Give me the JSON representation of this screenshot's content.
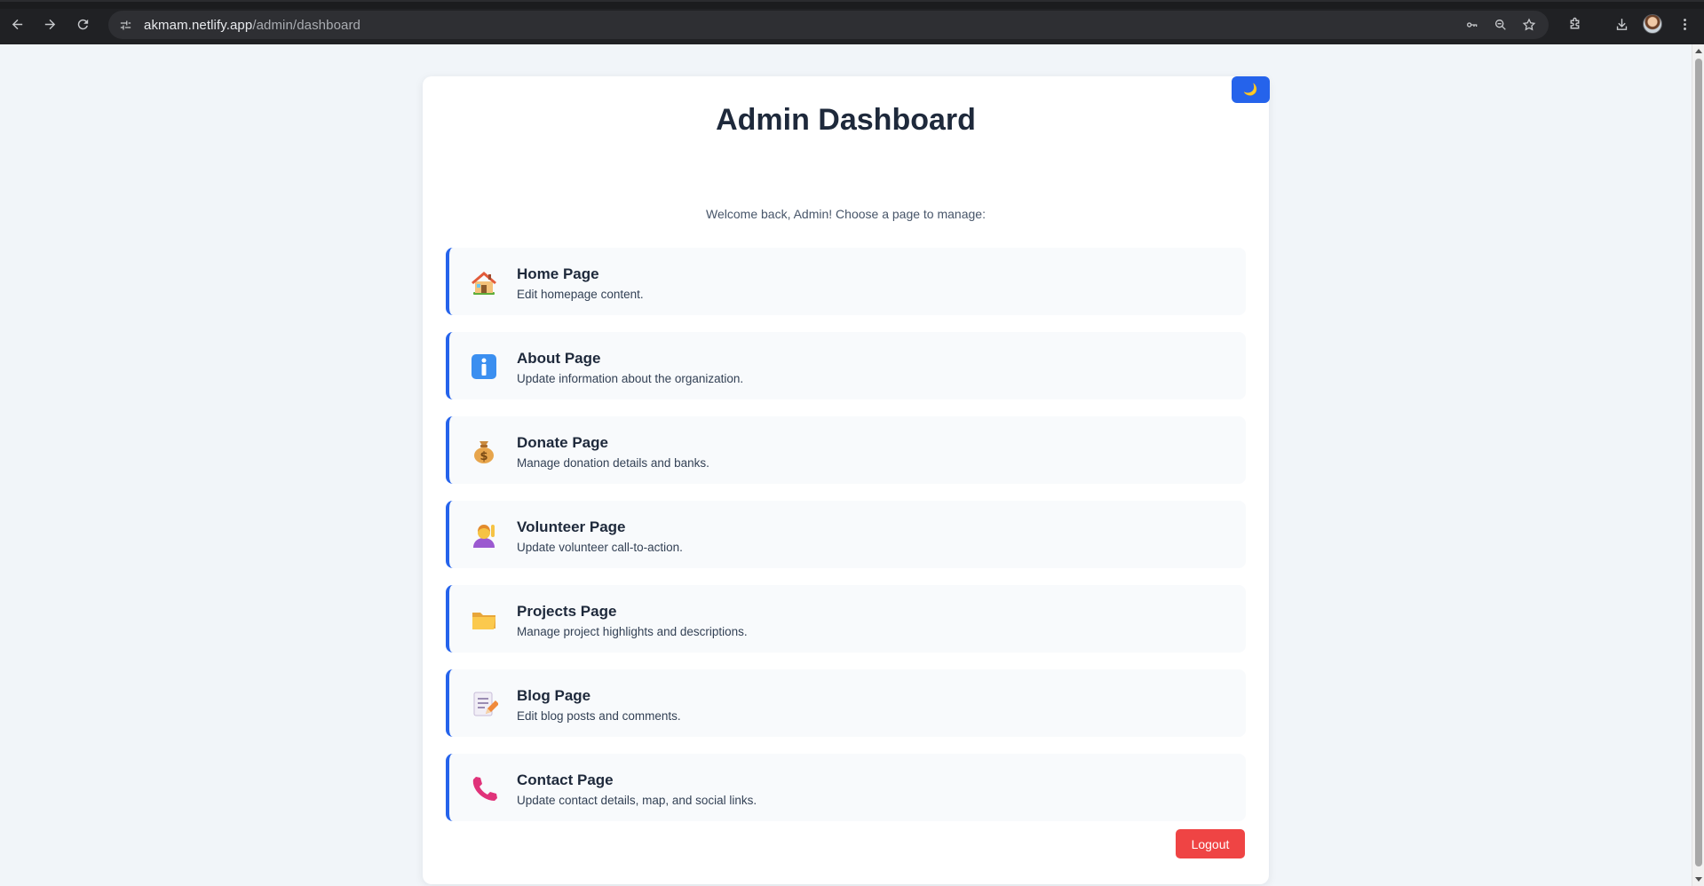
{
  "browser": {
    "url_host": "akmam.netlify.app",
    "url_path": "/admin/dashboard"
  },
  "page": {
    "theme_toggle_icon": "🌙",
    "title": "Admin Dashboard",
    "subtitle": "Welcome back, Admin! Choose a page to manage:",
    "items": [
      {
        "icon": "house-icon",
        "label": "Home Page",
        "description": "Edit homepage content."
      },
      {
        "icon": "info-icon",
        "label": "About Page",
        "description": "Update information about the organization."
      },
      {
        "icon": "money-bag-icon",
        "label": "Donate Page",
        "description": "Manage donation details and banks."
      },
      {
        "icon": "raising-hand-icon",
        "label": "Volunteer Page",
        "description": "Update volunteer call-to-action."
      },
      {
        "icon": "folder-icon",
        "label": "Projects Page",
        "description": "Manage project highlights and descriptions."
      },
      {
        "icon": "memo-icon",
        "label": "Blog Page",
        "description": "Edit blog posts and comments."
      },
      {
        "icon": "telephone-icon",
        "label": "Contact Page",
        "description": "Update contact details, map, and social links."
      }
    ],
    "logout_label": "Logout"
  },
  "colors": {
    "accent": "#2563eb",
    "danger": "#ef4444",
    "card_bg": "#ffffff",
    "item_bg": "#f8fafc",
    "page_bg": "#f1f5f9",
    "heading": "#1e293b"
  }
}
